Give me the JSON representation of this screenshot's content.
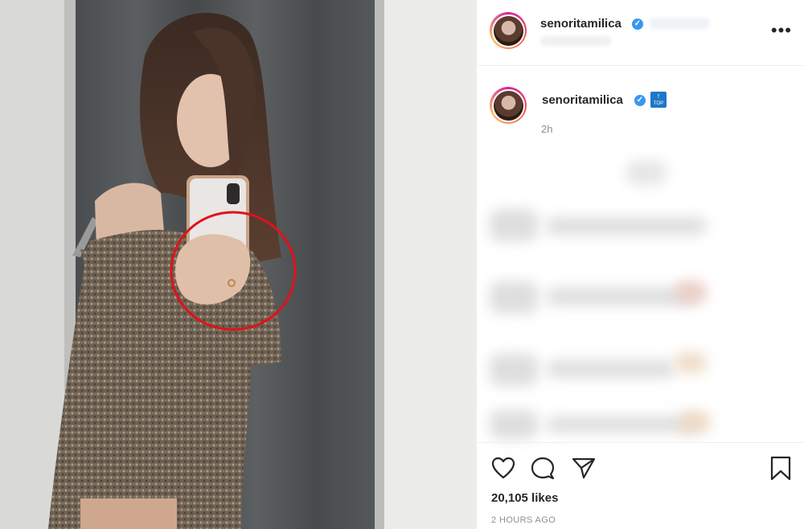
{
  "post": {
    "username": "senoritamilica",
    "caption_username": "senoritamilica",
    "caption_time": "2h",
    "likes": "20,105 likes",
    "posted_ago": "2 HOURS AGO"
  },
  "icons": {
    "verified": "verified-badge-icon",
    "more": "more-options-icon",
    "like": "heart-icon",
    "comment": "comment-icon",
    "share": "share-icon",
    "save": "bookmark-icon",
    "top": "top-emoji-icon"
  },
  "colors": {
    "verified_blue": "#3897f0",
    "annotation_circle": "#e0121a",
    "text_primary": "#262626",
    "text_secondary": "#8e8e8e"
  },
  "glyphs": {
    "verified_check": "✓",
    "more_dots": "•••",
    "top_arrow": "↑",
    "top_label": "TOP"
  }
}
